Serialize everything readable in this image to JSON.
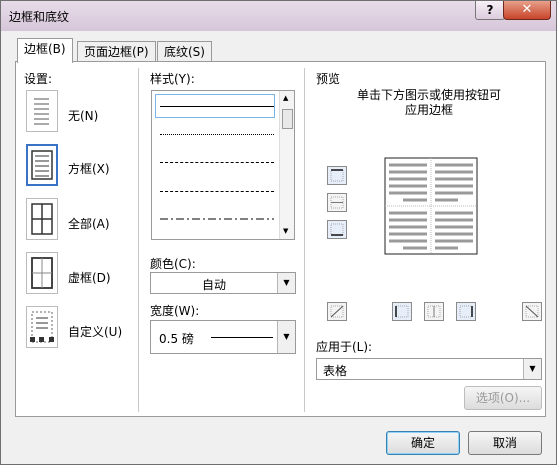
{
  "window": {
    "title": "边框和底纹",
    "help": "?",
    "close": "✕"
  },
  "tabs": [
    {
      "label": "边框(B)"
    },
    {
      "label": "页面边框(P)"
    },
    {
      "label": "底纹(S)"
    }
  ],
  "setting": {
    "heading": "设置:",
    "options": [
      {
        "label": "无(N)"
      },
      {
        "label": "方框(X)",
        "selected": true
      },
      {
        "label": "全部(A)"
      },
      {
        "label": "虚框(D)"
      },
      {
        "label": "自定义(U)"
      }
    ]
  },
  "style": {
    "heading": "样式(Y):",
    "items": [
      "solid",
      "dotted",
      "dashed-fine",
      "dashed",
      "dash-dot"
    ]
  },
  "color": {
    "label": "颜色(C):",
    "value": "自动"
  },
  "width": {
    "label": "宽度(W):",
    "value": "0.5 磅"
  },
  "preview": {
    "heading": "预览",
    "hint_line1": "单击下方图示或使用按钮可",
    "hint_line2": "应用边框"
  },
  "apply_to": {
    "label": "应用于(L):",
    "value": "表格"
  },
  "buttons": {
    "options": "选项(O)...",
    "ok": "确定",
    "cancel": "取消"
  },
  "colors": {
    "accent": "#3a72c6",
    "close": "#c8442a",
    "title_bg": "#d6c6d9"
  }
}
